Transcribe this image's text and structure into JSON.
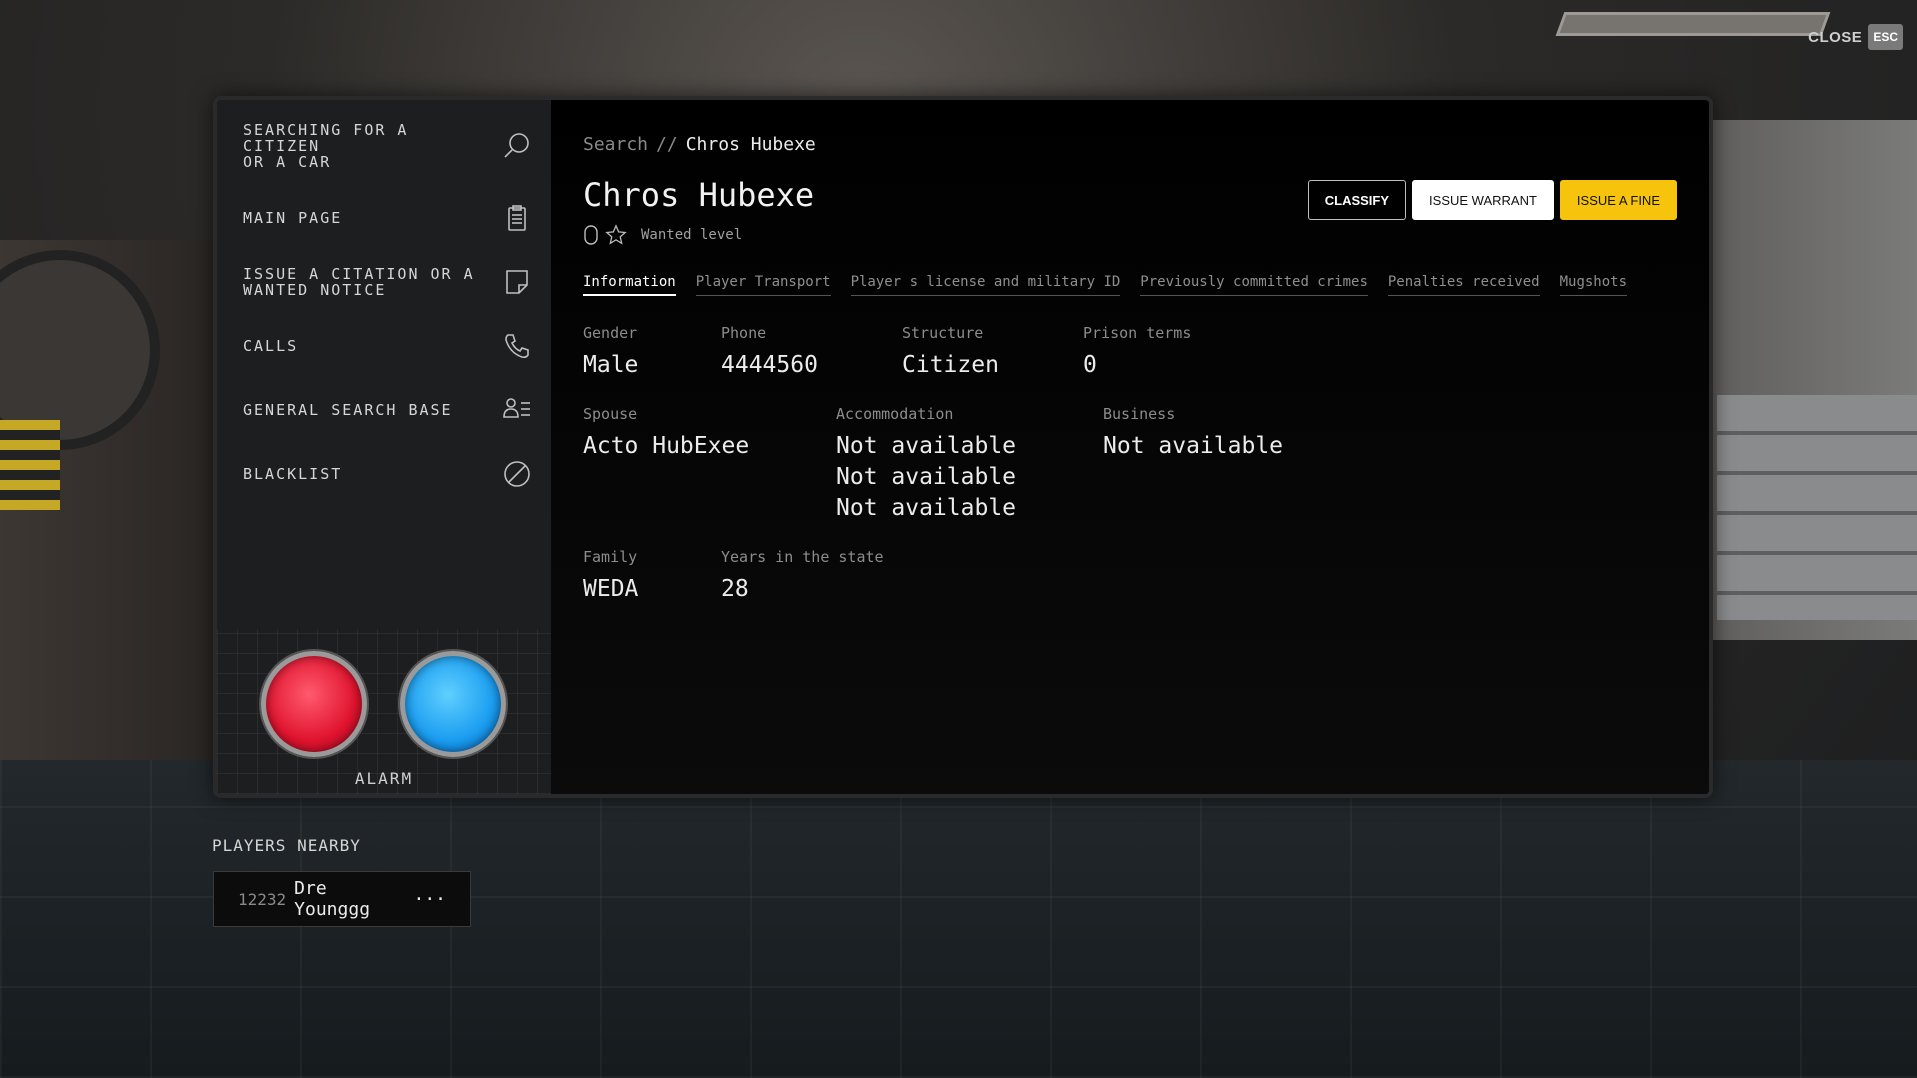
{
  "close": {
    "label": "CLOSE",
    "key": "ESC"
  },
  "sidebar": {
    "items": [
      {
        "label": "SEARCHING FOR A\nCITIZEN\nOR A CAR",
        "icon": "search-icon"
      },
      {
        "label": "MAIN PAGE",
        "icon": "clipboard-icon"
      },
      {
        "label": "ISSUE A CITATION OR A\nWANTED NOTICE",
        "icon": "note-icon"
      },
      {
        "label": "CALLS",
        "icon": "phone-icon"
      },
      {
        "label": "GENERAL SEARCH BASE",
        "icon": "user-list-icon"
      },
      {
        "label": "BLACKLIST",
        "icon": "blocked-icon"
      }
    ],
    "alarm_label": "ALARM",
    "alarm_colors": {
      "red": "#e0132e",
      "blue": "#1a9cf0"
    }
  },
  "breadcrumb": {
    "root": "Search",
    "separator": "//",
    "current": "Chros Hubexe"
  },
  "profile": {
    "name": "Chros Hubexe",
    "wanted_count": "0",
    "wanted_label": "Wanted level"
  },
  "actions": {
    "classify": "CLASSIFY",
    "warrant": "ISSUE WARRANT",
    "fine": "ISSUE A FINE",
    "accent": "#f6c40c"
  },
  "tabs": [
    {
      "label": "Information",
      "active": true
    },
    {
      "label": "Player Transport"
    },
    {
      "label": "Player s license and military ID"
    },
    {
      "label": "Previously committed crimes"
    },
    {
      "label": "Penalties received"
    },
    {
      "label": "Mugshots"
    }
  ],
  "info": {
    "gender": {
      "label": "Gender",
      "value": "Male"
    },
    "phone": {
      "label": "Phone",
      "value": "4444560"
    },
    "structure": {
      "label": "Structure",
      "value": "Citizen"
    },
    "prison": {
      "label": "Prison terms",
      "value": "0"
    },
    "spouse": {
      "label": "Spouse",
      "value": "Acto HubExee"
    },
    "accommodation": {
      "label": "Accommodation",
      "values": [
        "Not available",
        "Not available",
        "Not available"
      ]
    },
    "business": {
      "label": "Business",
      "value": "Not available"
    },
    "family": {
      "label": "Family",
      "value": "WEDA"
    },
    "years": {
      "label": "Years in the state",
      "value": "28"
    }
  },
  "players_nearby": {
    "title": "PLAYERS NEARBY",
    "items": [
      {
        "id": "12232",
        "name": "Dre Younggg",
        "more": "···"
      }
    ]
  }
}
